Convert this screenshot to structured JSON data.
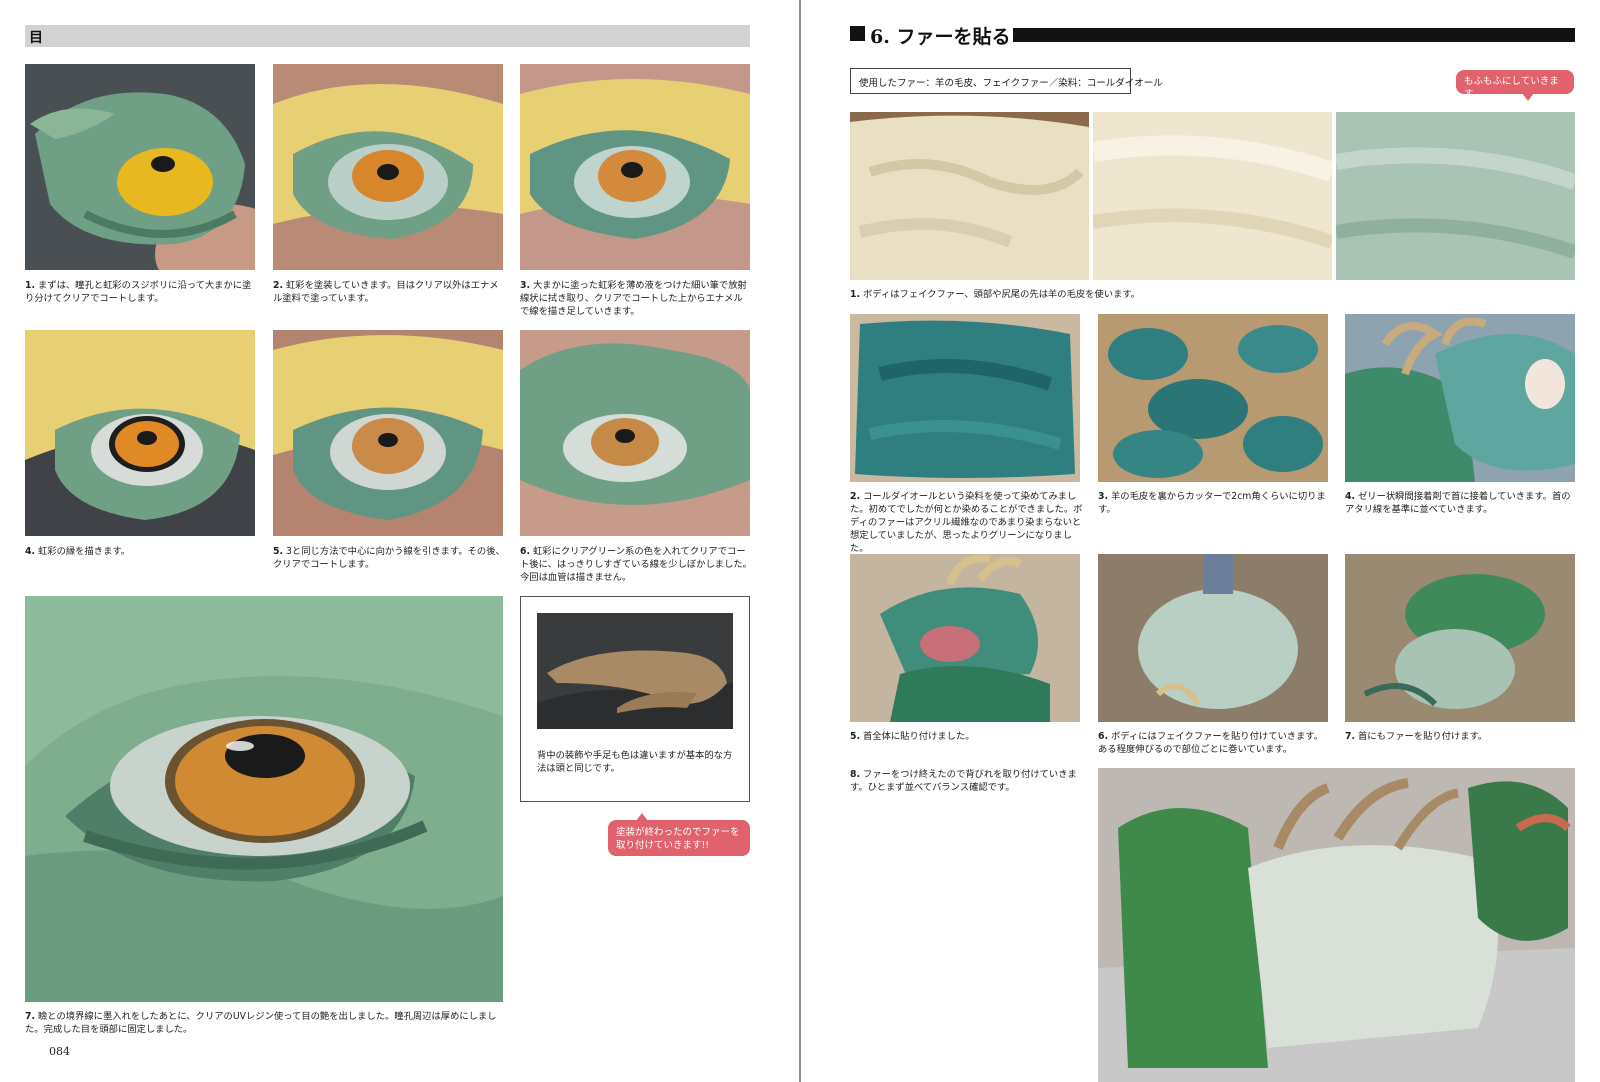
{
  "left_page": {
    "section_tag": "目",
    "captions": [
      {
        "num": "1.",
        "text": "まずは、瞳孔と虹彩のスジボリに沿って大まかに塗り分けてクリアでコートします。"
      },
      {
        "num": "2.",
        "text": "虹彩を塗装していきます。目はクリア以外はエナメル塗料で塗っています。"
      },
      {
        "num": "3.",
        "text": "大まかに塗った虹彩を薄め液をつけた細い筆で放射線状に拭き取り、クリアでコートした上からエナメルで線を描き足していきます。"
      },
      {
        "num": "4.",
        "text": "虹彩の縁を描きます。"
      },
      {
        "num": "5.",
        "text": "3と同じ方法で中心に向かう線を引きます。その後、クリアでコートします。"
      },
      {
        "num": "6.",
        "text": "虹彩にクリアグリーン系の色を入れてクリアでコート後に、はっきりしすぎている線を少しぼかしました。今回は血管は描きません。"
      },
      {
        "num": "7.",
        "text": "瞼との境界線に墨入れをしたあとに、クリアのUVレジン使って目の艶を出しました。瞳孔周辺は厚めにしました。完成した目を頭部に固定しました。"
      }
    ],
    "inset_text": "背中の装飾や手足も色は違いますが基本的な方法は頭と同じです。",
    "bubble_text": "塗装が終わったのでファーを取り付けていきます!!",
    "page_number": "084"
  },
  "right_page": {
    "heading_number": "6.",
    "heading_title": "ファーを貼る",
    "materials": "使用したファー：羊の毛皮、フェイクファー／染料：コールダイオール",
    "bubble_text": "もふもふにしていきます。",
    "captions": [
      {
        "num": "1.",
        "text": "ボディはフェイクファー、頭部や尻尾の先は羊の毛皮を使います。"
      },
      {
        "num": "2.",
        "text": "コールダイオールという染料を使って染めてみました。初めてでしたが何とか染めることができました。ボディのファーはアクリル繊維なのであまり染まらないと想定していましたが、思ったよりグリーンになりました。"
      },
      {
        "num": "3.",
        "text": "羊の毛皮を裏からカッターで2cm角くらいに切ります。"
      },
      {
        "num": "4.",
        "text": "ゼリー状瞬間接着剤で首に接着していきます。首のアタリ線を基準に並べていきます。"
      },
      {
        "num": "5.",
        "text": "首全体に貼り付けました。"
      },
      {
        "num": "6.",
        "text": "ボディにはフェイクファーを貼り付けていきます。ある程度伸びるので部位ごとに巻いています。"
      },
      {
        "num": "7.",
        "text": "首にもファーを貼り付けます。"
      },
      {
        "num": "8.",
        "text": "ファーをつけ終えたので背びれを取り付けていきます。ひとまず並べてバランス確認です。"
      }
    ]
  },
  "colors": {
    "accent_pink": "#e0626d",
    "header_gray": "#d2d2d2",
    "sculpt_green": "#6f9f84",
    "iris_orange": "#d7862c",
    "tape_yellow": "#e7cf73",
    "fur_teal": "#2f7f80",
    "fur_cream": "#efe6cf",
    "horn_bronze": "#a88a66"
  }
}
